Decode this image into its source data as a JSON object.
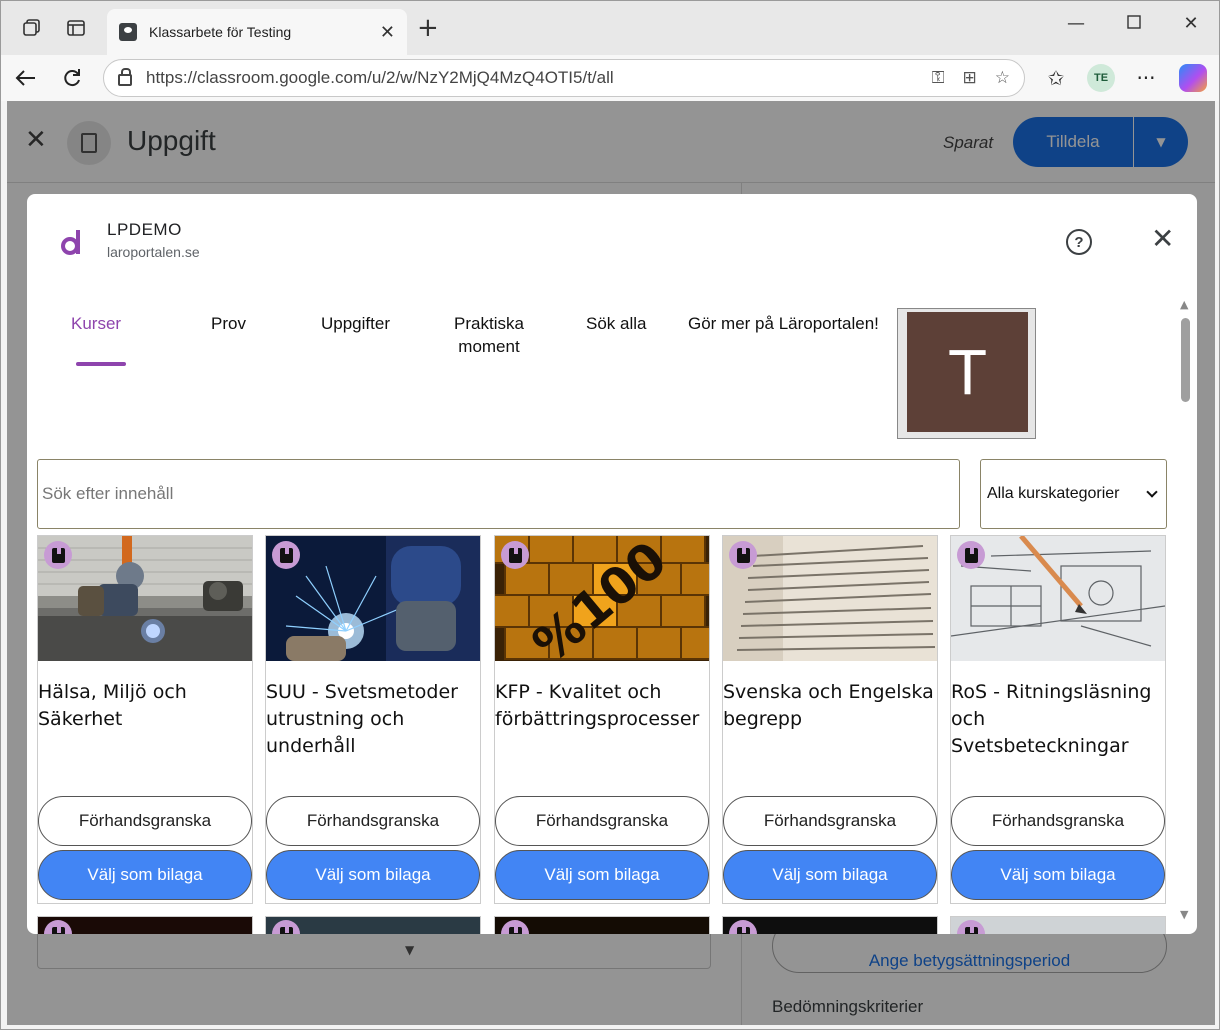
{
  "browser": {
    "tab_title": "Klassarbete för Testing",
    "url": "https://classroom.google.com/u/2/w/NzY2MjQ4MzQ4OTI5/t/all",
    "profile_initials": "TE"
  },
  "page": {
    "title": "Uppgift",
    "saved_text": "Sparat",
    "assign_label": "Tilldela",
    "grading_period_label": "Ange betygsättningsperiod",
    "criteria_label": "Bedömningskriterier"
  },
  "dialog": {
    "app_name": "LPDEMO",
    "app_domain": "laroportalen.se",
    "tabs": [
      {
        "label": "Kurser",
        "active": true
      },
      {
        "label": "Prov"
      },
      {
        "label": "Uppgifter"
      },
      {
        "label": "Praktiska moment"
      },
      {
        "label": "Sök alla"
      },
      {
        "label": "Gör mer på Läroportalen!"
      }
    ],
    "avatar_letter": "T",
    "search_placeholder": "Sök efter innehåll",
    "category_selected": "Alla kurskategorier",
    "cards": [
      {
        "title": "Hälsa, Miljö och Säkerhet",
        "preview": "Förhandsgranska",
        "attach": "Välj som bilaga"
      },
      {
        "title": "SUU - Svetsmetoder utrustning och underhåll",
        "preview": "Förhandsgranska",
        "attach": "Välj som bilaga"
      },
      {
        "title": "KFP - Kvalitet och förbättringsprocesser",
        "preview": "Förhandsgranska",
        "attach": "Välj som bilaga"
      },
      {
        "title": "Svenska och Engelska begrepp",
        "preview": "Förhandsgranska",
        "attach": "Välj som bilaga"
      },
      {
        "title": "RoS - Ritningsläsning och Svetsbeteckningar",
        "preview": "Förhandsgranska",
        "attach": "Välj som bilaga"
      }
    ],
    "card_image_text": "%100"
  },
  "colors": {
    "accent_purple": "#8e44ad",
    "attach_blue": "#4285f4",
    "classroom_blue": "#1a73e8",
    "avatar_brown": "#5d4037"
  }
}
